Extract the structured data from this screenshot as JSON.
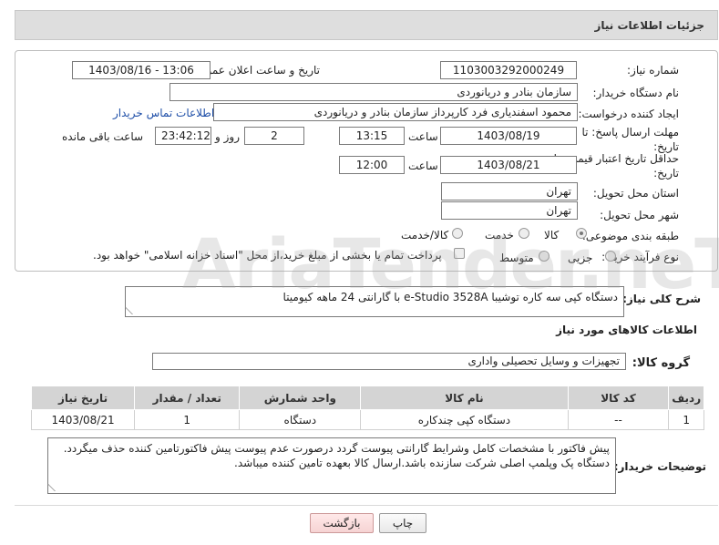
{
  "panel": {
    "title": "جزئیات اطلاعات نیاز"
  },
  "fields": {
    "need_number_label": "شماره نیاز:",
    "need_number": "1103003292000249",
    "announce_label": "تاریخ و ساعت اعلان عمومی:",
    "announce_value": "1403/08/16 - 13:06",
    "buyer_org_label": "نام دستگاه خریدار:",
    "buyer_org": "سازمان بنادر و دریانوردی",
    "creator_label": "ایجاد کننده درخواست:",
    "creator": "محمود اسفندیاری فرد کارپرداز سازمان بنادر و دریانوردی",
    "contact_link": "اطلاعات تماس خریدار",
    "deadline_label_1": "مهلت ارسال پاسخ: تا",
    "deadline_label_2": "تاریخ:",
    "deadline_date": "1403/08/19",
    "time_label": "ساعت",
    "deadline_time": "13:15",
    "days_value": "2",
    "days_label": "روز و",
    "remaining_time": "23:42:12",
    "remaining_label": "ساعت باقی مانده",
    "validity_label_1": "حداقل تاریخ اعتبار قیمت: تا",
    "validity_label_2": "تاریخ:",
    "validity_date": "1403/08/21",
    "validity_time_label": "ساعت",
    "validity_time": "12:00",
    "province_label": "استان محل تحویل:",
    "province": "تهران",
    "city_label": "شهر محل تحویل:",
    "city": "تهران",
    "category_label": "طبقه بندی موضوعی:",
    "category_options": [
      "کالا",
      "خدمت",
      "کالا/خدمت"
    ],
    "process_label": "نوع فرآیند خرید :",
    "process_options": [
      "جزیی",
      "متوسط"
    ],
    "payment_text": "پرداخت تمام یا بخشی از مبلغ خرید،از محل \"اسناد خزانه اسلامی\" خواهد بود."
  },
  "summary": {
    "label": "شرح کلی نیاز:",
    "value": "دستگاه کپی سه کاره توشیبا e-Studio 3528A با گارانتی 24 ماهه کیومیتا"
  },
  "goods": {
    "section_title": "اطلاعات کالاهای مورد نیاز",
    "group_label": "گروه کالا:",
    "group_value": "تجهیزات و وسایل تحصیلی واداری",
    "columns": [
      "ردیف",
      "کد کالا",
      "نام کالا",
      "واحد شمارش",
      "تعداد / مقدار",
      "تاریخ نیاز"
    ],
    "rows": [
      {
        "index": "1",
        "code": "--",
        "name": "دستگاه کپی چندکاره",
        "unit": "دستگاه",
        "qty": "1",
        "date": "1403/08/21"
      }
    ]
  },
  "notes": {
    "label": "توضیحات خریدار:",
    "line1": "پیش فاکتور با مشخصات کامل وشرایط گارانتی پیوست گردد درصورت عدم پیوست پیش فاکتورتامین کننده حذف میگردد.",
    "line2": "دستگاه پک وپلمپ اصلی شرکت سازنده باشد.ارسال کالا بعهده تامین کننده میباشد."
  },
  "buttons": {
    "print": "چاپ",
    "back": "بازگشت"
  },
  "watermark": {
    "text": "AriaTender.neT"
  }
}
